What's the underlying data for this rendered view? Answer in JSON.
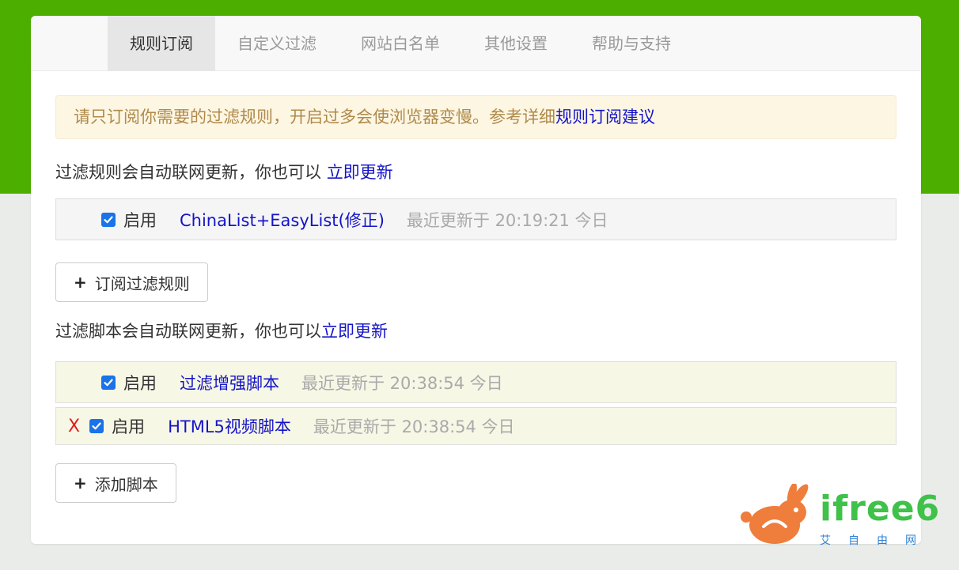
{
  "colors": {
    "header_band": "#4caf00",
    "link": "#1414c8",
    "alert_bg": "#fdf6e3",
    "alert_text": "#b08a4a",
    "delete": "#e21b1b",
    "logo_green": "#3fc14a",
    "logo_orange": "#ef7d3c"
  },
  "tabs": [
    {
      "label": "规则订阅",
      "active": true
    },
    {
      "label": "自定义过滤",
      "active": false
    },
    {
      "label": "网站白名单",
      "active": false
    },
    {
      "label": "其他设置",
      "active": false
    },
    {
      "label": "帮助与支持",
      "active": false
    }
  ],
  "alert": {
    "text": "请只订阅你需要的过滤规则，开启过多会使浏览器变慢。参考详细",
    "link": "规则订阅建议"
  },
  "rules_section": {
    "info": "过滤规则会自动联网更新，你也可以 ",
    "update_link": "立即更新",
    "items": [
      {
        "checked": true,
        "enable_label": "启用",
        "name": "ChinaList+EasyList(修正)",
        "updated": "最近更新于 20:19:21 今日"
      }
    ],
    "subscribe_button": "订阅过滤规则"
  },
  "scripts_section": {
    "info": "过滤脚本会自动联网更新，你也可以",
    "update_link": "立即更新",
    "items": [
      {
        "checked": true,
        "deletable": false,
        "enable_label": "启用",
        "name": "过滤增强脚本",
        "updated": "最近更新于 20:38:54 今日"
      },
      {
        "checked": true,
        "deletable": true,
        "delete_label": "X",
        "enable_label": "启用",
        "name": "HTML5视频脚本",
        "updated": "最近更新于 20:38:54 今日"
      }
    ],
    "add_button": "添加脚本"
  },
  "watermark": {
    "brand": "ifree6",
    "sub": "艾自由网",
    "icon": "rabbit-icon"
  }
}
